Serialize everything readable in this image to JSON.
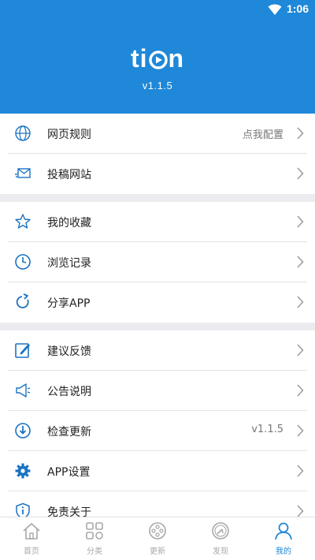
{
  "status_bar": {
    "time": "1:06"
  },
  "header": {
    "logo_text": "ti",
    "logo_tail": "n",
    "version": "v1.1.5"
  },
  "menu": {
    "groups": [
      [
        {
          "label": "网页规则",
          "value": "点我配置",
          "icon": "globe-icon"
        },
        {
          "label": "投稿网站",
          "value": "",
          "icon": "send-mail-icon"
        }
      ],
      [
        {
          "label": "我的收藏",
          "value": "",
          "icon": "star-icon"
        },
        {
          "label": "浏览记录",
          "value": "",
          "icon": "clock-icon"
        },
        {
          "label": "分享APP",
          "value": "",
          "icon": "share-icon"
        }
      ],
      [
        {
          "label": "建议反馈",
          "value": "",
          "icon": "edit-icon"
        },
        {
          "label": "公告说明",
          "value": "",
          "icon": "megaphone-icon"
        },
        {
          "label": "检查更新",
          "value": "v1.1.5",
          "icon": "download-icon"
        },
        {
          "label": "APP设置",
          "value": "",
          "icon": "gear-icon"
        },
        {
          "label": "免责关于",
          "value": "",
          "icon": "shield-info-icon"
        }
      ]
    ]
  },
  "tabbar": {
    "tabs": [
      {
        "label": "首页",
        "icon": "home-icon",
        "active": false
      },
      {
        "label": "分类",
        "icon": "category-icon",
        "active": false
      },
      {
        "label": "更新",
        "icon": "film-reel-icon",
        "active": false
      },
      {
        "label": "发现",
        "icon": "compass-icon",
        "active": false
      },
      {
        "label": "我的",
        "icon": "user-icon",
        "active": true
      }
    ]
  },
  "colors": {
    "accent": "#1f88d8",
    "inactive": "#a8a8a8",
    "icon_blue": "#1a73c2"
  }
}
